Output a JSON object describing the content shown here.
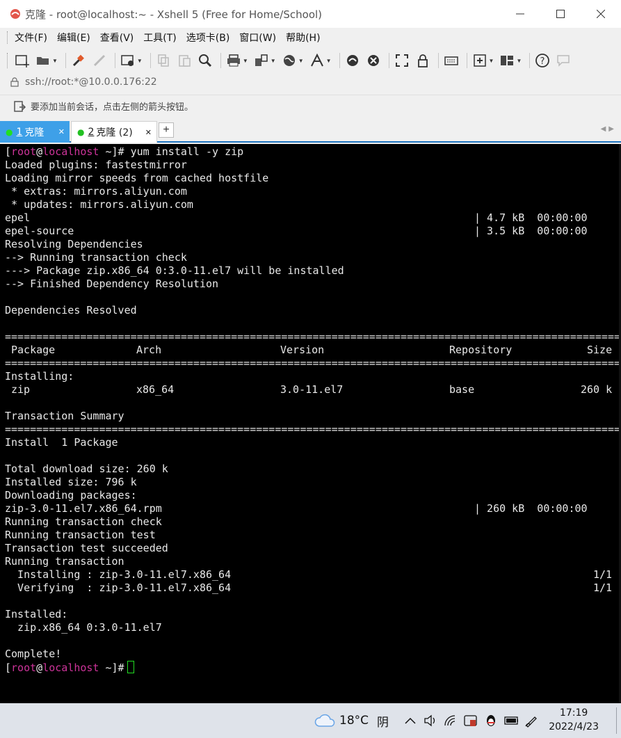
{
  "window": {
    "title": "克隆 - root@localhost:~ - Xshell 5 (Free for Home/School)"
  },
  "menu": [
    "文件(F)",
    "编辑(E)",
    "查看(V)",
    "工具(T)",
    "选项卡(B)",
    "窗口(W)",
    "帮助(H)"
  ],
  "address": {
    "value": "ssh://root:*@10.0.0.176:22"
  },
  "hint": {
    "text": "要添加当前会话，点击左侧的箭头按钮。"
  },
  "tabs": [
    {
      "num": "1",
      "label": "克隆",
      "status_color": "#22e022"
    },
    {
      "num": "2",
      "label": "克隆 (2)",
      "status_color": "#22c022"
    }
  ],
  "terminal": {
    "prompt_user": "root",
    "prompt_host": "localhost",
    "prompt_dir": "~",
    "command": "yum install -y zip",
    "lines": [
      "Loaded plugins: fastestmirror",
      "Loading mirror speeds from cached hostfile",
      " * extras: mirrors.aliyun.com",
      " * updates: mirrors.aliyun.com",
      "epel",
      "epel-source",
      "Resolving Dependencies",
      "--> Running transaction check",
      "---> Package zip.x86_64 0:3.0-11.el7 will be installed",
      "--> Finished Dependency Resolution",
      "",
      "Dependencies Resolved",
      "",
      "",
      "",
      "",
      "Installing:",
      "",
      "",
      "Transaction Summary",
      "",
      "Install  1 Package",
      "",
      "Total download size: 260 k",
      "Installed size: 796 k",
      "Downloading packages:",
      "zip-3.0-11.el7.x86_64.rpm",
      "Running transaction check",
      "Running transaction test",
      "Transaction test succeeded",
      "Running transaction",
      "  Installing : zip-3.0-11.el7.x86_64",
      "  Verifying  : zip-3.0-11.el7.x86_64",
      "",
      "Installed:",
      "  zip.x86_64 0:3.0-11.el7",
      "",
      "Complete!"
    ],
    "right_epel": "| 4.7 kB  00:00:00",
    "right_epel_source": "| 3.5 kB  00:00:00",
    "right_rpm": "| 260 kB  00:00:00",
    "right_install_count": "1/1",
    "right_verify_count": "1/1",
    "table": {
      "headers": [
        "Package",
        "Arch",
        "Version",
        "Repository",
        "Size"
      ],
      "row": [
        "zip",
        "x86_64",
        "3.0-11.el7",
        "base",
        "260 k"
      ]
    }
  },
  "taskbar": {
    "temperature": "18°C",
    "weather": "阴",
    "time": "17:19",
    "date": "2022/4/23"
  },
  "colors": {
    "prompt": "#cc3399",
    "cursor": "#22dd22",
    "tab_active": "#3ea0e8"
  }
}
